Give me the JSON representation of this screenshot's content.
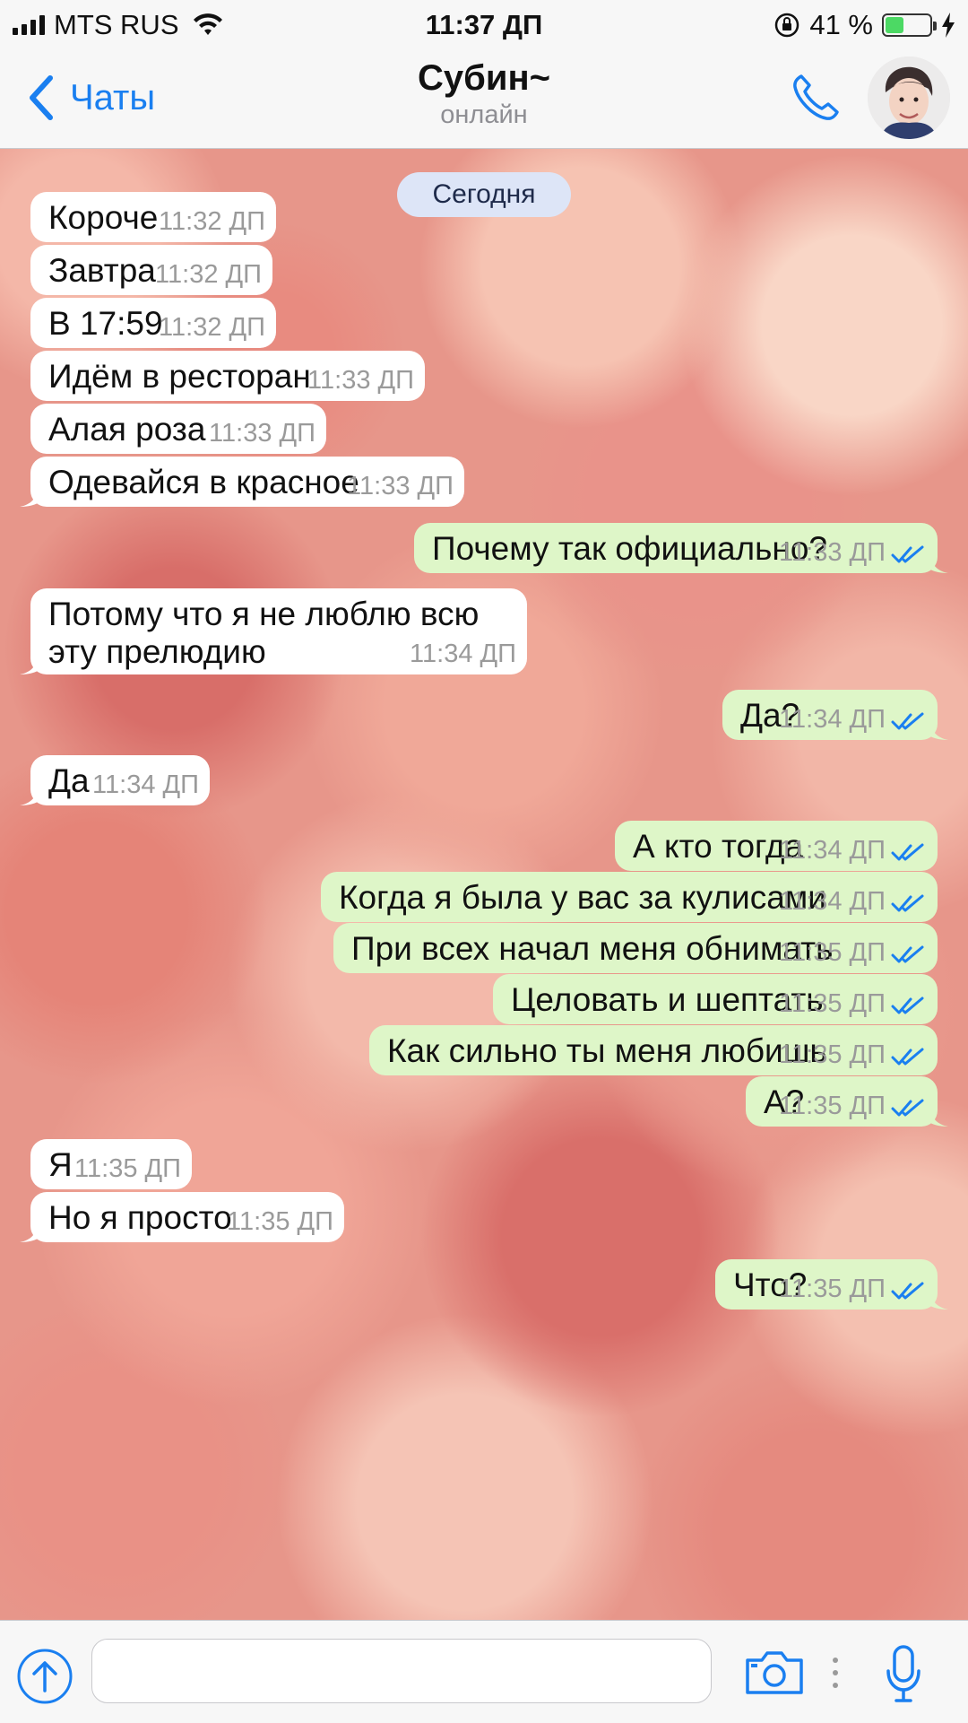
{
  "status_bar": {
    "carrier": "MTS RUS",
    "time": "11:37 ДП",
    "battery_text": "41 %",
    "battery_level": 0.41,
    "icons": [
      "signal-icon",
      "wifi-icon",
      "orientation-lock-icon",
      "battery-icon",
      "charging-icon"
    ]
  },
  "header": {
    "back_label": "Чаты",
    "title": "Субин~",
    "subtitle": "онлайн",
    "icons": [
      "back-chevron-icon",
      "phone-icon",
      "avatar"
    ],
    "accent_color": "#1a7ff0"
  },
  "chat": {
    "date_label": "Сегодня",
    "incoming_color": "#ffffff",
    "outgoing_color": "#def6c8",
    "messages": [
      {
        "dir": "in",
        "text": "Короче",
        "time": "11:32 ДП"
      },
      {
        "dir": "in",
        "text": "Завтра",
        "time": "11:32 ДП"
      },
      {
        "dir": "in",
        "text": "В 17:59",
        "time": "11:32 ДП"
      },
      {
        "dir": "in",
        "text": "Идём в ресторан",
        "time": "11:33 ДП"
      },
      {
        "dir": "in",
        "text": "Алая роза",
        "time": "11:33 ДП"
      },
      {
        "dir": "in",
        "text": "Одевайся в красное",
        "time": "11:33 ДП"
      },
      {
        "dir": "out",
        "text": "Почему так официально?",
        "time": "11:33 ДП"
      },
      {
        "dir": "in",
        "text": "Потому что я не люблю всю",
        "text2": "эту прелюдию",
        "time": "11:34 ДП"
      },
      {
        "dir": "out",
        "text": "Да?",
        "time": "11:34 ДП"
      },
      {
        "dir": "in",
        "text": "Да",
        "time": "11:34 ДП"
      },
      {
        "dir": "out",
        "text": "А кто тогда",
        "time": "11:34 ДП"
      },
      {
        "dir": "out",
        "text": "Когда я была у вас за кулисами",
        "time": "11:34 ДП"
      },
      {
        "dir": "out",
        "text": "При всех начал меня обнимать",
        "time": "11:35 ДП"
      },
      {
        "dir": "out",
        "text": "Целовать и шептать",
        "time": "11:35 ДП"
      },
      {
        "dir": "out",
        "text": "Как сильно ты меня любишь",
        "time": "11:35 ДП"
      },
      {
        "dir": "out",
        "text": "А?",
        "time": "11:35 ДП"
      },
      {
        "dir": "in",
        "text": "Я",
        "time": "11:35 ДП"
      },
      {
        "dir": "in",
        "text": "Но я просто",
        "time": "11:35 ДП"
      },
      {
        "dir": "out",
        "text": "Что?",
        "time": "11:35 ДП"
      }
    ]
  },
  "input_bar": {
    "placeholder": "",
    "icons": [
      "attach-arrow-icon",
      "camera-icon",
      "more-dots-icon",
      "microphone-icon"
    ]
  }
}
